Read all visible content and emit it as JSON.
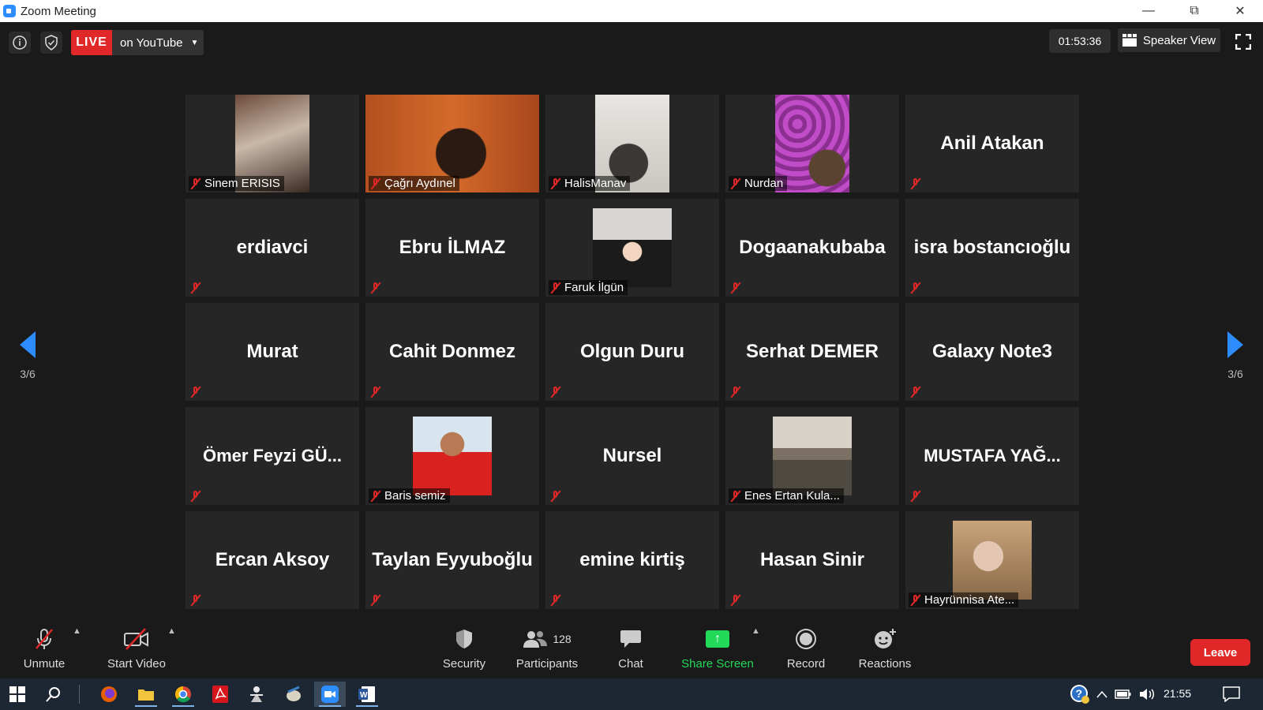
{
  "window": {
    "title": "Zoom Meeting",
    "controls": [
      "minimize-icon",
      "restore-icon",
      "close-icon"
    ]
  },
  "top_bar": {
    "live_badge": "LIVE",
    "live_target": "on YouTube",
    "timer": "01:53:36",
    "view_label": "Speaker View"
  },
  "pagination": {
    "left": "3/6",
    "right": "3/6"
  },
  "participants": [
    {
      "name": "Sinem ERISIS",
      "has_video": true
    },
    {
      "name": "Çağrı Aydınel",
      "has_video": true
    },
    {
      "name": "HalisManav",
      "has_video": true
    },
    {
      "name": "Nurdan",
      "has_video": true
    },
    {
      "name": "Anil Atakan",
      "has_video": false
    },
    {
      "name": "erdiavci",
      "has_video": false
    },
    {
      "name": "Ebru İLMAZ",
      "has_video": false
    },
    {
      "name": "Faruk İlgün",
      "has_video": true
    },
    {
      "name": "Dogaanakubaba",
      "has_video": false
    },
    {
      "name": "isra bostancıoğlu",
      "has_video": false
    },
    {
      "name": "Murat",
      "has_video": false
    },
    {
      "name": "Cahit Donmez",
      "has_video": false
    },
    {
      "name": "Olgun Duru",
      "has_video": false
    },
    {
      "name": "Serhat DEMER",
      "has_video": false
    },
    {
      "name": "Galaxy Note3",
      "has_video": false
    },
    {
      "name": "Ömer  Feyzi  GÜ...",
      "has_video": false
    },
    {
      "name": "Baris semiz",
      "has_video": true
    },
    {
      "name": "Nursel",
      "has_video": false
    },
    {
      "name": "Enes Ertan Kula...",
      "has_video": true
    },
    {
      "name": "MUSTAFA  YAĞ...",
      "has_video": false
    },
    {
      "name": "Ercan Aksoy",
      "has_video": false
    },
    {
      "name": "Taylan Eyyuboğlu",
      "has_video": false
    },
    {
      "name": "emine kirtiş",
      "has_video": false
    },
    {
      "name": "Hasan Sinir",
      "has_video": false
    },
    {
      "name": "Hayrünnisa Ate...",
      "has_video": true
    }
  ],
  "toolbar": {
    "unmute": "Unmute",
    "start_video": "Start Video",
    "security": "Security",
    "participants": "Participants",
    "participants_count": "128",
    "chat": "Chat",
    "share_screen": "Share Screen",
    "record": "Record",
    "reactions": "Reactions",
    "leave": "Leave"
  },
  "taskbar": {
    "clock": "21:55",
    "apps": [
      "windows-start-icon",
      "search-icon",
      "firefox-icon",
      "file-explorer-icon",
      "chrome-icon",
      "acrobat-icon",
      "app-icon",
      "app-icon",
      "zoom-icon",
      "word-icon"
    ]
  },
  "colors": {
    "accent": "#2d8cff",
    "live_red": "#e02828",
    "share_green": "#23d959",
    "mute_red": "#e02828"
  }
}
